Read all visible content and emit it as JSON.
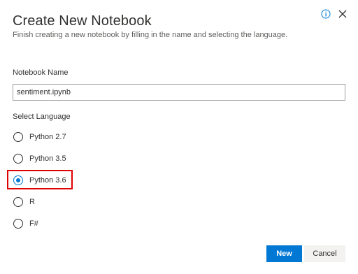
{
  "dialog": {
    "title": "Create New Notebook",
    "subtitle": "Finish creating a new notebook by filling in the name and selecting the language.",
    "info_icon": "info-icon",
    "close_icon": "close-icon"
  },
  "form": {
    "name_label": "Notebook Name",
    "name_value": "sentiment.ipynb",
    "language_label": "Select Language",
    "languages": [
      {
        "label": "Python 2.7",
        "checked": false
      },
      {
        "label": "Python 3.5",
        "checked": false
      },
      {
        "label": "Python 3.6",
        "checked": true
      },
      {
        "label": "R",
        "checked": false
      },
      {
        "label": "F#",
        "checked": false
      }
    ]
  },
  "buttons": {
    "primary_label": "New",
    "secondary_label": "Cancel"
  },
  "colors": {
    "accent": "#0078d4",
    "highlight": "#e00000"
  }
}
